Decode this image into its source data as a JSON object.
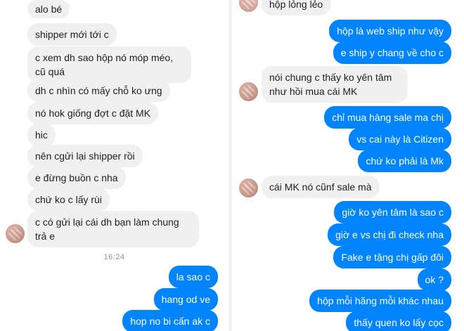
{
  "left_chat": {
    "messages": [
      {
        "text": "alo bé"
      },
      {
        "text": "shipper mới tới c"
      },
      {
        "text": "c xem dh sao hộp nó móp méo, cũ quá"
      },
      {
        "text": "dh c nhìn có mấy chỗ ko ưng"
      },
      {
        "text": "nó hok giống đợt c đặt MK"
      },
      {
        "text": "hic"
      },
      {
        "text": "nên cgửi lại shipper rồi"
      },
      {
        "text": "e đừng buồn c nha"
      },
      {
        "text": "chứ ko c lấy rùi"
      },
      {
        "text": "c có gửi lại cái dh bạn làm chung trả e"
      }
    ],
    "timestamp": "16:24",
    "replies": [
      {
        "text": "la sao c"
      },
      {
        "text": "hang od ve"
      },
      {
        "text": "hop no bi cấn ak c"
      }
    ]
  },
  "right_chat": {
    "messages": [
      {
        "text": "hộp lỏng lẻo"
      },
      {
        "text": "hộp là web ship như vậy"
      },
      {
        "text": "e ship y chang về cho c"
      },
      {
        "text": "nói chung c thấy ko yên tâm như hồi mua cái MK"
      },
      {
        "text": "chỉ mua hàng sale ma chị"
      },
      {
        "text": "vs cai này là Citizen"
      },
      {
        "text": "chứ ko phải là Mk"
      },
      {
        "text": "cái MK nó cũnf sale mà"
      },
      {
        "text": "giờ ko yên tâm là sao c"
      },
      {
        "text": "giờ e vs chị đi check nha"
      },
      {
        "text": "Fake e tặng chị gấp đôi"
      },
      {
        "text": "ok ?"
      },
      {
        "text": "hộp mỗi hãng mỗi khác nhau"
      },
      {
        "text": "thấy quen ko lấy cọc"
      }
    ]
  },
  "colors": {
    "incoming_bubble": "#f1f0f0",
    "outgoing_bubble": "#0084ff"
  }
}
